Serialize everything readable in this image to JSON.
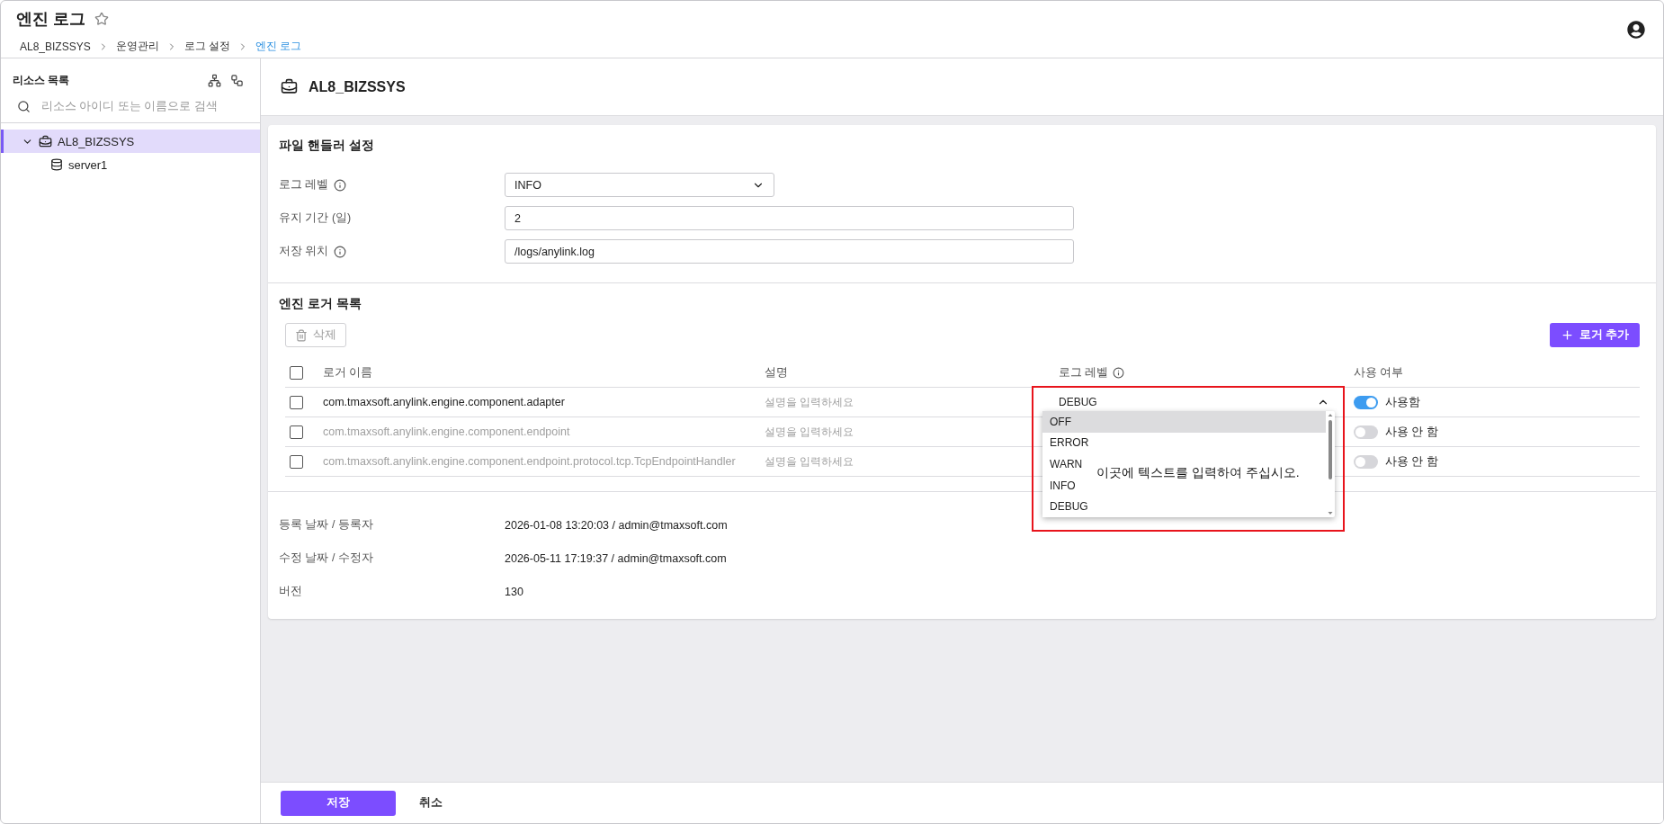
{
  "page": {
    "title": "엔진 로그",
    "favorite": false,
    "breadcrumb": [
      {
        "label": "AL8_BIZSSYS",
        "current": false
      },
      {
        "label": "운영관리",
        "current": false
      },
      {
        "label": "로그 설정",
        "current": false
      },
      {
        "label": "엔진 로그",
        "current": true
      }
    ]
  },
  "sidebar": {
    "title": "리소스 목록",
    "search": {
      "placeholder": "리소스 아이디 또는 이름으로 검색"
    },
    "tree": [
      {
        "label": "AL8_BIZSSYS",
        "kind": "group",
        "expanded": true,
        "selected": true,
        "children": [
          {
            "label": "server1",
            "kind": "server",
            "selected": false
          }
        ]
      }
    ]
  },
  "resource": {
    "title": "AL8_BIZSSYS"
  },
  "file_handler": {
    "title": "파일 핸들러 설정",
    "fields": [
      {
        "label": "로그 레벨",
        "info": true,
        "kind": "select",
        "value": "INFO"
      },
      {
        "label": "유지 기간 (일)",
        "info": false,
        "kind": "text",
        "value": "2"
      },
      {
        "label": "저장 위치",
        "info": true,
        "kind": "text",
        "value": "/logs/anylink.log"
      }
    ]
  },
  "loggers": {
    "title": "엔진 로거 목록",
    "delete_button": {
      "label": "삭제",
      "disabled": true
    },
    "add_button": {
      "label": "로거 추가"
    },
    "header_checked": false,
    "columns": [
      {
        "label": "로거 이름",
        "info": false
      },
      {
        "label": "설명",
        "info": false
      },
      {
        "label": "로그 레벨",
        "info": true
      },
      {
        "label": "사용 여부",
        "info": false
      }
    ],
    "rows": [
      {
        "checked": false,
        "name": "com.tmaxsoft.anylink.engine.component.adapter",
        "description_placeholder": "설명을 입력하세요",
        "level": "DEBUG",
        "menu_open": true,
        "enabled": true,
        "enabled_label": "사용함"
      },
      {
        "checked": false,
        "name": "com.tmaxsoft.anylink.engine.component.endpoint",
        "description_placeholder": "설명을 입력하세요",
        "menu_open": false,
        "enabled": false,
        "enabled_label": "사용 안 함"
      },
      {
        "checked": false,
        "name": "com.tmaxsoft.anylink.engine.component.endpoint.protocol.tcp.TcpEndpointHandler",
        "description_placeholder": "설명을 입력하세요",
        "menu_open": false,
        "enabled": false,
        "enabled_label": "사용 안 함"
      }
    ],
    "level_options": [
      {
        "label": "OFF",
        "selected": true
      },
      {
        "label": "ERROR",
        "selected": false
      },
      {
        "label": "WARN",
        "selected": false
      },
      {
        "label": "INFO",
        "selected": false
      },
      {
        "label": "DEBUG",
        "selected": false
      }
    ]
  },
  "annotation": {
    "highlighted": true,
    "note": "이곳에 텍스트를 입력하여 주십시오."
  },
  "meta": [
    {
      "label": "등록 날짜 / 등록자",
      "value": "2026-01-08 13:20:03 / admin@tmaxsoft.com"
    },
    {
      "label": "수정 날짜 / 수정자",
      "value": "2026-05-11 17:19:37 / admin@tmaxsoft.com"
    },
    {
      "label": "버전",
      "value": "130"
    }
  ],
  "footer": {
    "buttons": [
      {
        "label": "저장",
        "kind": "primary"
      },
      {
        "label": "취소",
        "kind": "text"
      }
    ]
  }
}
